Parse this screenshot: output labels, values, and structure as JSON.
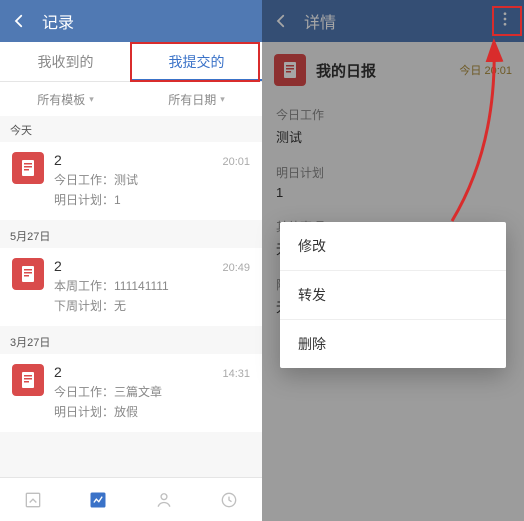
{
  "left": {
    "header": {
      "title": "记录"
    },
    "tabs": {
      "received": "我收到的",
      "submitted": "我提交的"
    },
    "filters": {
      "template": "所有模板",
      "date": "所有日期"
    },
    "groups": [
      {
        "label": "今天",
        "items": [
          {
            "title": "2",
            "time": "20:01",
            "line1": "今日工作：测试",
            "line2": "明日计划：1"
          }
        ]
      },
      {
        "label": "5月27日",
        "items": [
          {
            "title": "2",
            "time": "20:49",
            "line1": "本周工作：111141111",
            "line2": "下周计划：无"
          }
        ]
      },
      {
        "label": "3月27日",
        "items": [
          {
            "title": "2",
            "time": "14:31",
            "line1": "今日工作：三篇文章",
            "line2": "明日计划：放假"
          }
        ]
      }
    ]
  },
  "right": {
    "header": {
      "title": "详情"
    },
    "report": {
      "title": "我的日报",
      "time_prefix": "今日",
      "time": "20:01",
      "sections": [
        {
          "label": "今日工作",
          "body": "测试"
        },
        {
          "label": "明日计划",
          "body": "1"
        },
        {
          "label": "其他事项",
          "body": "无"
        },
        {
          "label": "附件",
          "body": "无"
        }
      ]
    },
    "menu": {
      "edit": "修改",
      "forward": "转发",
      "delete": "删除"
    }
  }
}
